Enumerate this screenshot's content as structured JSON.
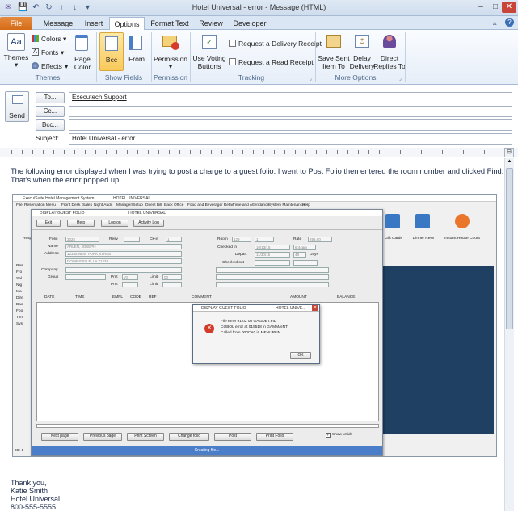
{
  "window": {
    "title": "Hotel Universal - error - Message (HTML)"
  },
  "ribbon_tabs": [
    "File",
    "Message",
    "Insert",
    "Options",
    "Format Text",
    "Review",
    "Developer"
  ],
  "themes_group": {
    "themes": "Themes",
    "colors": "Colors",
    "fonts": "Fonts",
    "effects": "Effects",
    "page_color_1": "Page",
    "page_color_2": "Color",
    "label": "Themes"
  },
  "show_fields": {
    "bcc": "Bcc",
    "from": "From",
    "label": "Show Fields"
  },
  "permission": {
    "button": "Permission",
    "label": "Permission"
  },
  "tracking": {
    "voting_1": "Use Voting",
    "voting_2": "Buttons",
    "delivery_receipt": "Request a Delivery Receipt",
    "read_receipt": "Request a Read Receipt",
    "label": "Tracking"
  },
  "more_options": {
    "save_sent_1": "Save Sent",
    "save_sent_2": "Item To",
    "delay_1": "Delay",
    "delay_2": "Delivery",
    "direct_1": "Direct",
    "direct_2": "Replies To",
    "label": "More Options"
  },
  "header": {
    "send": "Send",
    "to_button": "To...",
    "cc_button": "Cc...",
    "bcc_button": "Bcc...",
    "subject_label": "Subject:",
    "to_value": "Executech Support",
    "cc_value": "",
    "bcc_value": "",
    "subject_value": "Hotel Universal - error"
  },
  "body": {
    "paragraph": "The following error displayed when I was trying to post a charge to a guest folio.  I went to Post Folio then entered the room number and clicked Find.  That’s when the error popped up.",
    "signature": [
      "Thank you,",
      "Katie Smith",
      "Hotel Universal",
      "800-555-5555"
    ]
  },
  "screenshot": {
    "app_title": "Execu/Suite Hotel Management System",
    "app_title_right": "HOTEL UNIVERSAL",
    "menu": [
      "File",
      "Reservation Menu",
      "Front Desk",
      "Sales",
      "Night Audit",
      "Manager/Setup",
      "Direct Bill",
      "Back Office",
      "Food and Beverage/ Retail",
      "Time and Attendance",
      "System Maintenance",
      "Help"
    ],
    "tiles": [
      "Gift Cards",
      "Dinner Resv",
      "Instant House Count"
    ],
    "left_cut": "Resp",
    "tree": [
      "Res",
      "Fro",
      "Sal",
      "Nig",
      "Ma",
      "Dire",
      "Bac",
      "Foo",
      "Tim",
      "Sys"
    ],
    "status": "ID: 1",
    "folio": {
      "title": "DISPLAY GUEST FOLIO",
      "title_right": "HOTEL UNIVERSAL",
      "buttons": [
        "Exit",
        "Help",
        "Log on",
        "Activity Log"
      ],
      "labels": {
        "folio": "Folio",
        "name": "Name",
        "address": "Address",
        "company": "Company",
        "group": "Group",
        "resv": "Resv",
        "ckin": "Ck-in",
        "pmt1": "Pmt",
        "pmt2": "Pmt",
        "limit1": "Limit",
        "limit2": "Limit",
        "room": "Room",
        "rate": "Rate",
        "checked_in": "Checked in",
        "depart": "Depart",
        "days": "Days",
        "checked_out": "Checked out"
      },
      "values": {
        "folio": "3025",
        "name": "ARLEN, JOSEPH",
        "address1": "12345 NEW YORK STREET",
        "address2": "DOWNSVILLE, LA  71234",
        "ckin": "1",
        "pmt1": "VS",
        "limit1": "00",
        "room": "129",
        "room2": "1",
        "rate": "295.00",
        "checked_in": "10/13/15",
        "checked_in_time": "6:44am",
        "depart": "11/30/15",
        "days": "48"
      },
      "columns": [
        "DATE",
        "TIME",
        "EMPL",
        "CODE",
        "REF",
        "COMMENT",
        "AMOUNT",
        "BALANCE"
      ],
      "bottom_buttons": [
        "Next page",
        "Previous page",
        "Print Screen",
        "Change folio",
        "Post",
        "Print Folio"
      ],
      "show_voids": "Show Voids",
      "creating_file": "Creating file..."
    },
    "error": {
      "title": "DISPLAY GUEST FOLIO",
      "title_right": "HOTEL UNIVE...",
      "lines": [
        "File error 91,02 on GAGDET.FIL",
        "COBOL error at 015518 in GAMMAINT",
        "Called from 000CA0 in MENURUN"
      ],
      "ok": "OK"
    }
  },
  "colors": {
    "file_tab": "#d9731e",
    "accent": "#2b579a",
    "status_bar": "#4a7ec8"
  }
}
